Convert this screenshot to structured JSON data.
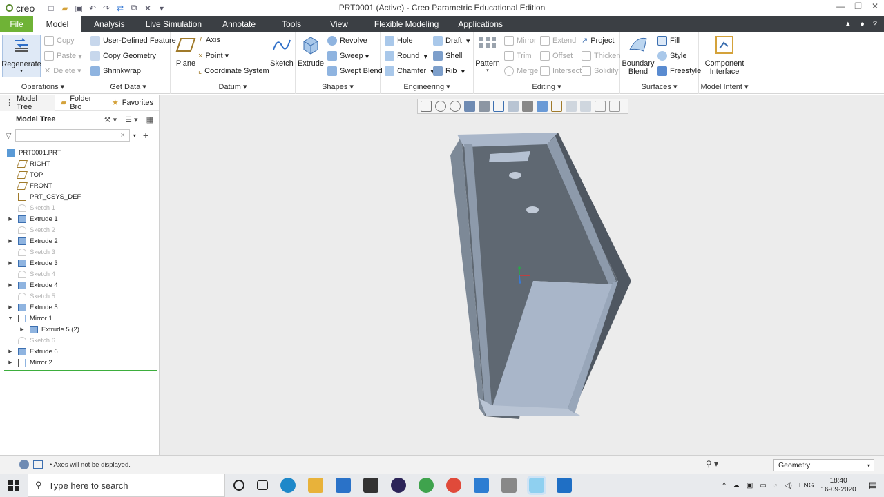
{
  "app": {
    "logo": "creo",
    "window_title": "PRT0001 (Active) - Creo Parametric Educational Edition"
  },
  "menu": {
    "tabs": [
      "File",
      "Model",
      "Analysis",
      "Live Simulation",
      "Annotate",
      "Tools",
      "View",
      "Flexible Modeling",
      "Applications"
    ],
    "active": "Model"
  },
  "ribbon": {
    "operations": {
      "label": "Operations",
      "regenerate": "Regenerate",
      "copy": "Copy",
      "paste": "Paste",
      "delete": "Delete"
    },
    "get_data": {
      "label": "Get Data",
      "udf": "User-Defined Feature",
      "copy_geometry": "Copy Geometry",
      "shrinkwrap": "Shrinkwrap"
    },
    "datum": {
      "label": "Datum",
      "plane": "Plane",
      "axis": "Axis",
      "point": "Point",
      "csys": "Coordinate System",
      "sketch": "Sketch"
    },
    "shapes": {
      "label": "Shapes",
      "extrude": "Extrude",
      "revolve": "Revolve",
      "sweep": "Sweep",
      "swept_blend": "Swept Blend"
    },
    "engineering": {
      "label": "Engineering",
      "hole": "Hole",
      "round": "Round",
      "chamfer": "Chamfer",
      "draft": "Draft",
      "shell": "Shell",
      "rib": "Rib"
    },
    "editing": {
      "label": "Editing",
      "pattern": "Pattern",
      "mirror": "Mirror",
      "trim": "Trim",
      "merge": "Merge",
      "extend": "Extend",
      "offset": "Offset",
      "intersect": "Intersect",
      "project": "Project",
      "thicken": "Thicken",
      "solidify": "Solidify"
    },
    "surfaces": {
      "label": "Surfaces",
      "boundary_blend_1": "Boundary",
      "boundary_blend_2": "Blend",
      "fill": "Fill",
      "style": "Style",
      "freestyle": "Freestyle"
    },
    "model_intent": {
      "label": "Model Intent",
      "component_1": "Component",
      "component_2": "Interface"
    }
  },
  "panel": {
    "tabs": [
      "Model Tree",
      "Folder Bro",
      "Favorites"
    ],
    "title": "Model Tree",
    "filter_placeholder": "",
    "tree": [
      {
        "label": "PRT0001.PRT",
        "dim": false,
        "expander": "",
        "indent": 0,
        "icon": "part"
      },
      {
        "label": "RIGHT",
        "dim": false,
        "expander": "",
        "indent": 1,
        "icon": "plane"
      },
      {
        "label": "TOP",
        "dim": false,
        "expander": "",
        "indent": 1,
        "icon": "plane"
      },
      {
        "label": "FRONT",
        "dim": false,
        "expander": "",
        "indent": 1,
        "icon": "plane"
      },
      {
        "label": "PRT_CSYS_DEF",
        "dim": false,
        "expander": "",
        "indent": 1,
        "icon": "csys"
      },
      {
        "label": "Sketch 1",
        "dim": true,
        "expander": "",
        "indent": 1,
        "icon": "sketch"
      },
      {
        "label": "Extrude 1",
        "dim": false,
        "expander": "▶",
        "indent": 1,
        "icon": "extrude"
      },
      {
        "label": "Sketch 2",
        "dim": true,
        "expander": "",
        "indent": 1,
        "icon": "sketch"
      },
      {
        "label": "Extrude 2",
        "dim": false,
        "expander": "▶",
        "indent": 1,
        "icon": "extrude"
      },
      {
        "label": "Sketch 3",
        "dim": true,
        "expander": "",
        "indent": 1,
        "icon": "sketch"
      },
      {
        "label": "Extrude 3",
        "dim": false,
        "expander": "▶",
        "indent": 1,
        "icon": "extrude"
      },
      {
        "label": "Sketch 4",
        "dim": true,
        "expander": "",
        "indent": 1,
        "icon": "sketch"
      },
      {
        "label": "Extrude 4",
        "dim": false,
        "expander": "▶",
        "indent": 1,
        "icon": "extrude"
      },
      {
        "label": "Sketch 5",
        "dim": true,
        "expander": "",
        "indent": 1,
        "icon": "sketch"
      },
      {
        "label": "Extrude 5",
        "dim": false,
        "expander": "▶",
        "indent": 1,
        "icon": "extrude"
      },
      {
        "label": "Mirror 1",
        "dim": false,
        "expander": "▼",
        "indent": 1,
        "icon": "mirror"
      },
      {
        "label": "Extrude 5 (2)",
        "dim": false,
        "expander": "▶",
        "indent": 2,
        "icon": "extrude"
      },
      {
        "label": "Sketch 6",
        "dim": true,
        "expander": "",
        "indent": 1,
        "icon": "sketch"
      },
      {
        "label": "Extrude 6",
        "dim": false,
        "expander": "▶",
        "indent": 1,
        "icon": "extrude"
      },
      {
        "label": "Mirror 2",
        "dim": false,
        "expander": "▶",
        "indent": 1,
        "icon": "mirror"
      }
    ]
  },
  "status": {
    "message": "Axes will not be displayed.",
    "filter_value": "Geometry"
  },
  "taskbar": {
    "search_placeholder": "Type here to search",
    "lang": "ENG",
    "time": "18:40",
    "date": "16-09-2020"
  },
  "colors": {
    "menu_bg": "#3b3f44",
    "file_tab": "#6fb336",
    "model_light": "#a9b6c9",
    "model_mid": "#8593a8",
    "model_dark": "#5f6872"
  }
}
